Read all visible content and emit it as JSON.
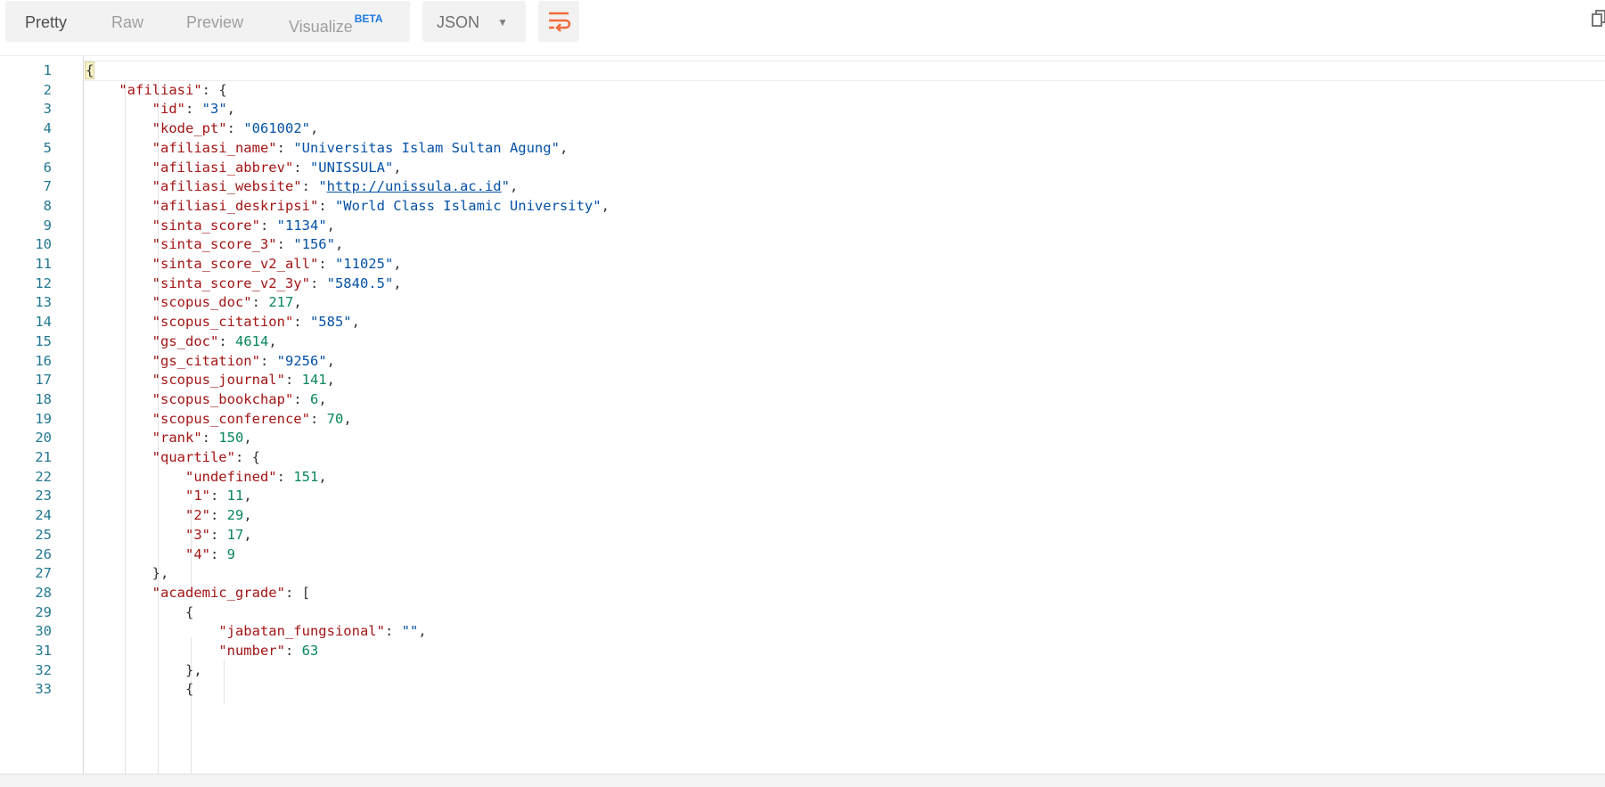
{
  "toolbar": {
    "tabs": [
      {
        "label": "Pretty",
        "active": true
      },
      {
        "label": "Raw",
        "active": false
      },
      {
        "label": "Preview",
        "active": false
      },
      {
        "label": "Visualize",
        "badge": "BETA",
        "active": false
      }
    ],
    "format": {
      "selected": "JSON"
    },
    "wrap_icon": "wrap-lines-icon",
    "copy_icon": "copy-icon"
  },
  "colors": {
    "key": "#a31515",
    "string": "#0451a5",
    "number": "#098658",
    "line_number": "#237893",
    "wrap_icon": "#f26b3a",
    "beta_badge": "#1f7ae0"
  },
  "editor": {
    "lines": [
      {
        "n": "1",
        "tokens": [
          {
            "t": "{",
            "c": "pun",
            "cursor": true
          }
        ]
      },
      {
        "n": "2",
        "tokens": [
          {
            "t": "    ",
            "c": "pun"
          },
          {
            "t": "\"afiliasi\"",
            "c": "key"
          },
          {
            "t": ": {",
            "c": "pun"
          }
        ]
      },
      {
        "n": "3",
        "tokens": [
          {
            "t": "        ",
            "c": "pun"
          },
          {
            "t": "\"id\"",
            "c": "key"
          },
          {
            "t": ": ",
            "c": "pun"
          },
          {
            "t": "\"3\"",
            "c": "str"
          },
          {
            "t": ",",
            "c": "pun"
          }
        ]
      },
      {
        "n": "4",
        "tokens": [
          {
            "t": "        ",
            "c": "pun"
          },
          {
            "t": "\"kode_pt\"",
            "c": "key"
          },
          {
            "t": ": ",
            "c": "pun"
          },
          {
            "t": "\"061002\"",
            "c": "str"
          },
          {
            "t": ",",
            "c": "pun"
          }
        ]
      },
      {
        "n": "5",
        "tokens": [
          {
            "t": "        ",
            "c": "pun"
          },
          {
            "t": "\"afiliasi_name\"",
            "c": "key"
          },
          {
            "t": ": ",
            "c": "pun"
          },
          {
            "t": "\"Universitas Islam Sultan Agung\"",
            "c": "str"
          },
          {
            "t": ",",
            "c": "pun"
          }
        ]
      },
      {
        "n": "6",
        "tokens": [
          {
            "t": "        ",
            "c": "pun"
          },
          {
            "t": "\"afiliasi_abbrev\"",
            "c": "key"
          },
          {
            "t": ": ",
            "c": "pun"
          },
          {
            "t": "\"UNISSULA\"",
            "c": "str"
          },
          {
            "t": ",",
            "c": "pun"
          }
        ]
      },
      {
        "n": "7",
        "tokens": [
          {
            "t": "        ",
            "c": "pun"
          },
          {
            "t": "\"afiliasi_website\"",
            "c": "key"
          },
          {
            "t": ": ",
            "c": "pun"
          },
          {
            "t": "\"",
            "c": "str"
          },
          {
            "t": "http://unissula.ac.id",
            "c": "url"
          },
          {
            "t": "\"",
            "c": "str"
          },
          {
            "t": ",",
            "c": "pun"
          }
        ]
      },
      {
        "n": "8",
        "tokens": [
          {
            "t": "        ",
            "c": "pun"
          },
          {
            "t": "\"afiliasi_deskripsi\"",
            "c": "key"
          },
          {
            "t": ": ",
            "c": "pun"
          },
          {
            "t": "\"World Class Islamic University\"",
            "c": "str"
          },
          {
            "t": ",",
            "c": "pun"
          }
        ]
      },
      {
        "n": "9",
        "tokens": [
          {
            "t": "        ",
            "c": "pun"
          },
          {
            "t": "\"sinta_score\"",
            "c": "key"
          },
          {
            "t": ": ",
            "c": "pun"
          },
          {
            "t": "\"1134\"",
            "c": "str"
          },
          {
            "t": ",",
            "c": "pun"
          }
        ]
      },
      {
        "n": "10",
        "tokens": [
          {
            "t": "        ",
            "c": "pun"
          },
          {
            "t": "\"sinta_score_3\"",
            "c": "key"
          },
          {
            "t": ": ",
            "c": "pun"
          },
          {
            "t": "\"156\"",
            "c": "str"
          },
          {
            "t": ",",
            "c": "pun"
          }
        ]
      },
      {
        "n": "11",
        "tokens": [
          {
            "t": "        ",
            "c": "pun"
          },
          {
            "t": "\"sinta_score_v2_all\"",
            "c": "key"
          },
          {
            "t": ": ",
            "c": "pun"
          },
          {
            "t": "\"11025\"",
            "c": "str"
          },
          {
            "t": ",",
            "c": "pun"
          }
        ]
      },
      {
        "n": "12",
        "tokens": [
          {
            "t": "        ",
            "c": "pun"
          },
          {
            "t": "\"sinta_score_v2_3y\"",
            "c": "key"
          },
          {
            "t": ": ",
            "c": "pun"
          },
          {
            "t": "\"5840.5\"",
            "c": "str"
          },
          {
            "t": ",",
            "c": "pun"
          }
        ]
      },
      {
        "n": "13",
        "tokens": [
          {
            "t": "        ",
            "c": "pun"
          },
          {
            "t": "\"scopus_doc\"",
            "c": "key"
          },
          {
            "t": ": ",
            "c": "pun"
          },
          {
            "t": "217",
            "c": "num"
          },
          {
            "t": ",",
            "c": "pun"
          }
        ]
      },
      {
        "n": "14",
        "tokens": [
          {
            "t": "        ",
            "c": "pun"
          },
          {
            "t": "\"scopus_citation\"",
            "c": "key"
          },
          {
            "t": ": ",
            "c": "pun"
          },
          {
            "t": "\"585\"",
            "c": "str"
          },
          {
            "t": ",",
            "c": "pun"
          }
        ]
      },
      {
        "n": "15",
        "tokens": [
          {
            "t": "        ",
            "c": "pun"
          },
          {
            "t": "\"gs_doc\"",
            "c": "key"
          },
          {
            "t": ": ",
            "c": "pun"
          },
          {
            "t": "4614",
            "c": "num"
          },
          {
            "t": ",",
            "c": "pun"
          }
        ]
      },
      {
        "n": "16",
        "tokens": [
          {
            "t": "        ",
            "c": "pun"
          },
          {
            "t": "\"gs_citation\"",
            "c": "key"
          },
          {
            "t": ": ",
            "c": "pun"
          },
          {
            "t": "\"9256\"",
            "c": "str"
          },
          {
            "t": ",",
            "c": "pun"
          }
        ]
      },
      {
        "n": "17",
        "tokens": [
          {
            "t": "        ",
            "c": "pun"
          },
          {
            "t": "\"scopus_journal\"",
            "c": "key"
          },
          {
            "t": ": ",
            "c": "pun"
          },
          {
            "t": "141",
            "c": "num"
          },
          {
            "t": ",",
            "c": "pun"
          }
        ]
      },
      {
        "n": "18",
        "tokens": [
          {
            "t": "        ",
            "c": "pun"
          },
          {
            "t": "\"scopus_bookchap\"",
            "c": "key"
          },
          {
            "t": ": ",
            "c": "pun"
          },
          {
            "t": "6",
            "c": "num"
          },
          {
            "t": ",",
            "c": "pun"
          }
        ]
      },
      {
        "n": "19",
        "tokens": [
          {
            "t": "        ",
            "c": "pun"
          },
          {
            "t": "\"scopus_conference\"",
            "c": "key"
          },
          {
            "t": ": ",
            "c": "pun"
          },
          {
            "t": "70",
            "c": "num"
          },
          {
            "t": ",",
            "c": "pun"
          }
        ]
      },
      {
        "n": "20",
        "tokens": [
          {
            "t": "        ",
            "c": "pun"
          },
          {
            "t": "\"rank\"",
            "c": "key"
          },
          {
            "t": ": ",
            "c": "pun"
          },
          {
            "t": "150",
            "c": "num"
          },
          {
            "t": ",",
            "c": "pun"
          }
        ]
      },
      {
        "n": "21",
        "tokens": [
          {
            "t": "        ",
            "c": "pun"
          },
          {
            "t": "\"quartile\"",
            "c": "key"
          },
          {
            "t": ": {",
            "c": "pun"
          }
        ]
      },
      {
        "n": "22",
        "tokens": [
          {
            "t": "            ",
            "c": "pun"
          },
          {
            "t": "\"undefined\"",
            "c": "key"
          },
          {
            "t": ": ",
            "c": "pun"
          },
          {
            "t": "151",
            "c": "num"
          },
          {
            "t": ",",
            "c": "pun"
          }
        ]
      },
      {
        "n": "23",
        "tokens": [
          {
            "t": "            ",
            "c": "pun"
          },
          {
            "t": "\"1\"",
            "c": "key"
          },
          {
            "t": ": ",
            "c": "pun"
          },
          {
            "t": "11",
            "c": "num"
          },
          {
            "t": ",",
            "c": "pun"
          }
        ]
      },
      {
        "n": "24",
        "tokens": [
          {
            "t": "            ",
            "c": "pun"
          },
          {
            "t": "\"2\"",
            "c": "key"
          },
          {
            "t": ": ",
            "c": "pun"
          },
          {
            "t": "29",
            "c": "num"
          },
          {
            "t": ",",
            "c": "pun"
          }
        ]
      },
      {
        "n": "25",
        "tokens": [
          {
            "t": "            ",
            "c": "pun"
          },
          {
            "t": "\"3\"",
            "c": "key"
          },
          {
            "t": ": ",
            "c": "pun"
          },
          {
            "t": "17",
            "c": "num"
          },
          {
            "t": ",",
            "c": "pun"
          }
        ]
      },
      {
        "n": "26",
        "tokens": [
          {
            "t": "            ",
            "c": "pun"
          },
          {
            "t": "\"4\"",
            "c": "key"
          },
          {
            "t": ": ",
            "c": "pun"
          },
          {
            "t": "9",
            "c": "num"
          }
        ]
      },
      {
        "n": "27",
        "tokens": [
          {
            "t": "        },",
            "c": "pun"
          }
        ]
      },
      {
        "n": "28",
        "tokens": [
          {
            "t": "        ",
            "c": "pun"
          },
          {
            "t": "\"academic_grade\"",
            "c": "key"
          },
          {
            "t": ": [",
            "c": "pun"
          }
        ]
      },
      {
        "n": "29",
        "tokens": [
          {
            "t": "            {",
            "c": "pun"
          }
        ]
      },
      {
        "n": "30",
        "tokens": [
          {
            "t": "                ",
            "c": "pun"
          },
          {
            "t": "\"jabatan_fungsional\"",
            "c": "key"
          },
          {
            "t": ": ",
            "c": "pun"
          },
          {
            "t": "\"\"",
            "c": "str"
          },
          {
            "t": ",",
            "c": "pun"
          }
        ]
      },
      {
        "n": "31",
        "tokens": [
          {
            "t": "                ",
            "c": "pun"
          },
          {
            "t": "\"number\"",
            "c": "key"
          },
          {
            "t": ": ",
            "c": "pun"
          },
          {
            "t": "63",
            "c": "num"
          }
        ]
      },
      {
        "n": "32",
        "tokens": [
          {
            "t": "            },",
            "c": "pun"
          }
        ]
      },
      {
        "n": "33",
        "tokens": [
          {
            "t": "            {",
            "c": "pun"
          }
        ]
      }
    ]
  }
}
